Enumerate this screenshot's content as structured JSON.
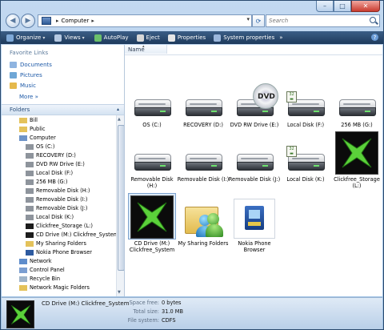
{
  "window": {
    "caption_buttons": {
      "minimize": "–",
      "maximize": "□",
      "close": "✕"
    }
  },
  "address": {
    "breadcrumb_item": "Computer",
    "breadcrumb_arrow": "▸",
    "search_placeholder": "Search"
  },
  "toolbar": {
    "items": [
      {
        "label": "Organize",
        "has_menu": true
      },
      {
        "label": "Views",
        "has_menu": true
      },
      {
        "label": "AutoPlay",
        "has_menu": false
      },
      {
        "label": "Eject",
        "has_menu": false
      },
      {
        "label": "Properties",
        "has_menu": false
      },
      {
        "label": "System properties",
        "has_menu": false
      }
    ],
    "overflow": "»",
    "help": "?"
  },
  "favorites": {
    "heading": "Favorite Links",
    "items": [
      {
        "label": "Documents"
      },
      {
        "label": "Pictures"
      },
      {
        "label": "Music"
      }
    ],
    "more": "More »"
  },
  "folders": {
    "heading": "Folders",
    "tree": [
      {
        "label": "Bill",
        "indent": 1
      },
      {
        "label": "Public",
        "indent": 1
      },
      {
        "label": "Computer",
        "indent": 1
      },
      {
        "label": "OS (C:)",
        "indent": 2
      },
      {
        "label": "RECOVERY (D:)",
        "indent": 2
      },
      {
        "label": "DVD RW Drive (E:)",
        "indent": 2
      },
      {
        "label": "Local Disk (F:)",
        "indent": 2
      },
      {
        "label": "256 MB (G:)",
        "indent": 2
      },
      {
        "label": "Removable Disk (H:)",
        "indent": 2
      },
      {
        "label": "Removable Disk (I:)",
        "indent": 2
      },
      {
        "label": "Removable Disk (J:)",
        "indent": 2
      },
      {
        "label": "Local Disk (K:)",
        "indent": 2
      },
      {
        "label": "Clickfree_Storage (L:)",
        "indent": 2
      },
      {
        "label": "CD Drive (M:) Clickfree_System",
        "indent": 2
      },
      {
        "label": "My Sharing Folders",
        "indent": 2
      },
      {
        "label": "Nokia Phone Browser",
        "indent": 2
      },
      {
        "label": "Network",
        "indent": 1
      },
      {
        "label": "Control Panel",
        "indent": 1
      },
      {
        "label": "Recycle Bin",
        "indent": 1
      },
      {
        "label": "Network Magic Folders",
        "indent": 1
      }
    ]
  },
  "main": {
    "column_name": "Name",
    "items": [
      {
        "label": "OS (C:)",
        "kind": "drive"
      },
      {
        "label": "RECOVERY (D:)",
        "kind": "drive"
      },
      {
        "label": "DVD RW Drive (E:)",
        "kind": "dvd",
        "disc_text": "DVD"
      },
      {
        "label": "Local Disk (F:)",
        "kind": "drive-badge"
      },
      {
        "label": "256 MB (G:)",
        "kind": "drive"
      },
      {
        "label": "Removable Disk (H:)",
        "kind": "drive"
      },
      {
        "label": "Removable Disk (I:)",
        "kind": "drive"
      },
      {
        "label": "Removable Disk (J:)",
        "kind": "drive"
      },
      {
        "label": "Local Disk (K:)",
        "kind": "drive-badge"
      },
      {
        "label": "Clickfree_Storage (L:)",
        "kind": "clickfree"
      },
      {
        "label": "CD Drive (M:) Clickfree_System",
        "kind": "clickfree",
        "selected": true
      },
      {
        "label": "My Sharing Folders",
        "kind": "sharing"
      },
      {
        "label": "Nokia Phone Browser",
        "kind": "nokia"
      }
    ]
  },
  "status": {
    "name": "CD Drive (M:) Clickfree_System",
    "space_free_label": "Space free:",
    "space_free": "0 bytes",
    "total_size_label": "Total size:",
    "total_size": "31.0 MB",
    "file_system_label": "File system:",
    "file_system": "CDFS"
  },
  "colors": {
    "accent": "#1e5aa8",
    "toolbar": "#2c4a6e",
    "clickfree_green": "#5bd13a"
  }
}
